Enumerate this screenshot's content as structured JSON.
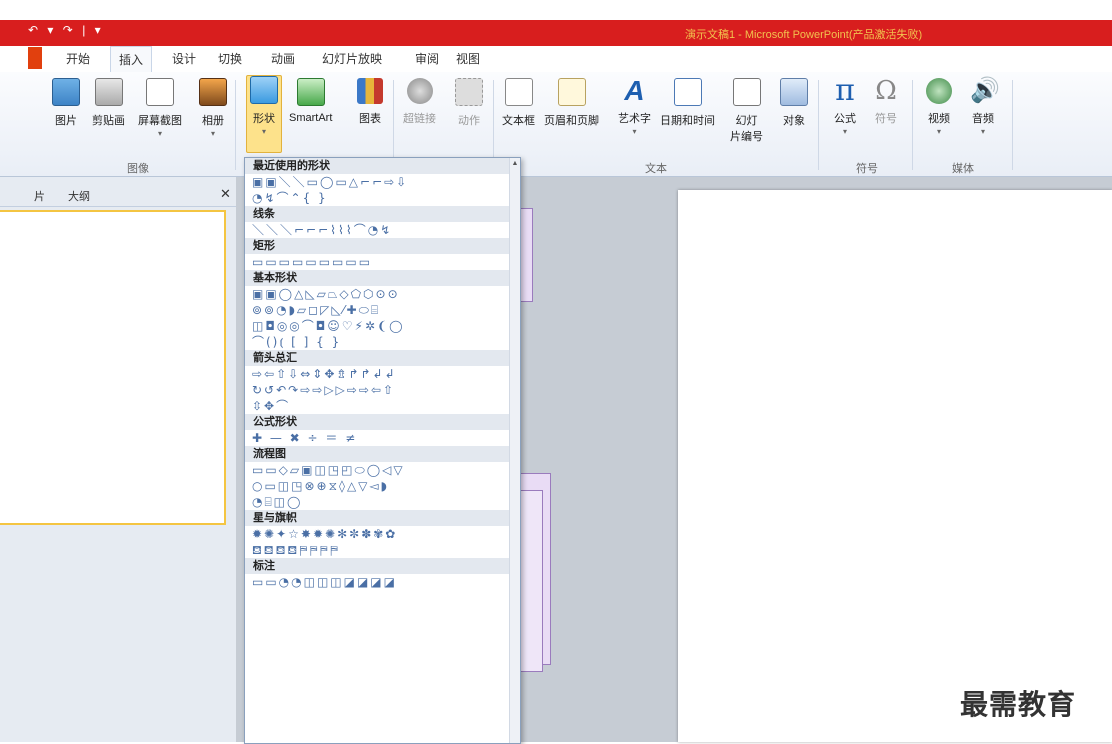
{
  "app": {
    "title": "演示文稿1 - Microsoft PowerPoint(产品激活失败)",
    "quick_access": [
      "↶",
      "▾",
      "↷",
      "|",
      "▾"
    ]
  },
  "tabs": [
    {
      "label": "开始",
      "active": false
    },
    {
      "label": "插入",
      "active": true
    },
    {
      "label": "设计",
      "active": false
    },
    {
      "label": "切换",
      "active": false
    },
    {
      "label": "动画",
      "active": false
    },
    {
      "label": "幻灯片放映",
      "active": false
    },
    {
      "label": "审阅",
      "active": false
    },
    {
      "label": "视图",
      "active": false
    }
  ],
  "ribbon": {
    "buttons": {
      "picture": "图片",
      "clipart": "剪贴画",
      "screenshot": "屏幕截图",
      "album": "相册",
      "shapes": "形状",
      "smartart": "SmartArt",
      "chart": "图表",
      "hyperlink": "超链接",
      "action": "动作",
      "textbox": "文本框",
      "header_footer": "页眉和页脚",
      "wordart": "艺术字",
      "datetime": "日期和时间",
      "slide_number_1": "幻灯",
      "slide_number_2": "片编号",
      "object": "对象",
      "equation": "公式",
      "symbol": "符号",
      "video": "视频",
      "audio": "音频"
    },
    "groups": {
      "images": "图像",
      "text": "文本",
      "symbols": "符号",
      "media": "媒体"
    },
    "icons": {
      "wordart_glyph": "A",
      "equation_glyph": "π",
      "symbol_glyph": "Ω",
      "audio_glyph": "🔊"
    }
  },
  "left_panel": {
    "tab_slides": "片",
    "tab_outline": "大纲",
    "close": "✕"
  },
  "shapes_menu": {
    "sections": [
      {
        "title": "最近使用的形状",
        "rows": [
          "▣▣＼＼▭◯▭△⌐⌐⇨⇩",
          "◔↯⌒⌃{ }"
        ]
      },
      {
        "title": "线条",
        "rows": [
          "＼＼＼⌐⌐⌐⌇⌇⌇⌒◔↯"
        ]
      },
      {
        "title": "矩形",
        "rows": [
          "▭▭▭▭▭▭▭▭▭"
        ]
      },
      {
        "title": "基本形状",
        "rows": [
          "▣▣◯△◺▱⏢◇⬠⬡⊙⊙",
          "⊚⊚◔◗▱◻◸◺⁄✚⬭⌸",
          "◫◘◎◎⌒◘☺♡⚡✲❨◯",
          "⌒()⦅ [ ] { }"
        ]
      },
      {
        "title": "箭头总汇",
        "rows": [
          "⇨⇦⇧⇩⇔⇕✥⇯↱↱↲↲",
          "↻↺↶↷⇨⇨▷▷⇨⇨⇦⇧",
          "⇳✥⌒"
        ]
      },
      {
        "title": "公式形状",
        "rows": [
          "✚ — ✖ ÷ ＝ ≠"
        ]
      },
      {
        "title": "流程图",
        "rows": [
          "▭▭◇▱▣◫◳◰⬭◯◁▽",
          "○▭◫◳⊗⊕⧖◊△▽◅◗",
          "◔⌸◫◯"
        ]
      },
      {
        "title": "星与旗帜",
        "rows": [
          "✹✺✦☆✸✹✺✻✼✽✾✿",
          "⛾⛾⛾⛾⛿⛿⛿⛿"
        ]
      },
      {
        "title": "标注",
        "rows": [
          "▭▭◔◔◫◫◫◪◪◪◪"
        ]
      }
    ],
    "scroll_up": "▲"
  },
  "watermark": "最需教育"
}
